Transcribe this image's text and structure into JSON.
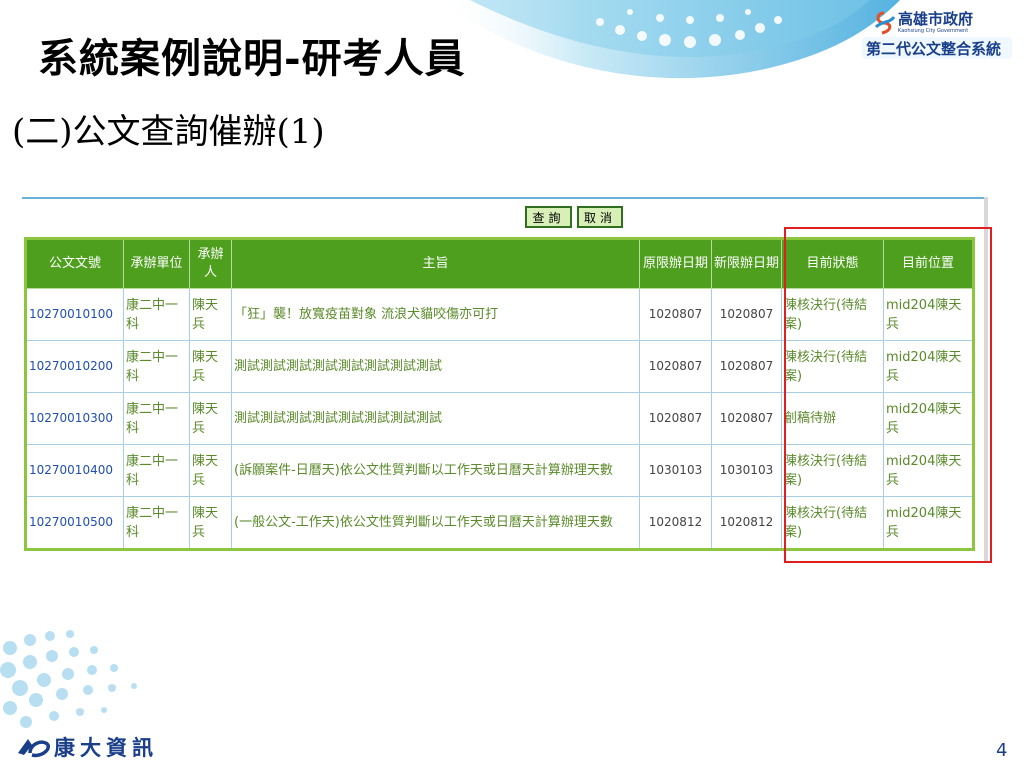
{
  "slide": {
    "title": "系統案例說明-研考人員",
    "subtitle": "(二)公文查詢催辦(1)",
    "page_number": "4"
  },
  "gov_logo": {
    "name": "高雄市政府",
    "english": "Kaohsiung City Government",
    "system": "第二代公文整合系統"
  },
  "company": {
    "name": "康大資訊"
  },
  "toolbar": {
    "query_label": "查詢",
    "cancel_label": "取消"
  },
  "table": {
    "columns": [
      "公文文號",
      "承辦單位",
      "承辦人",
      "主旨",
      "原限辦日期",
      "新限辦日期",
      "目前狀態",
      "目前位置"
    ],
    "rows": [
      {
        "doc_no": "10270010100",
        "unit": "康二中一科",
        "person": "陳天兵",
        "subject": "「狂」襲！放寬疫苗對象 流浪犬貓咬傷亦可打",
        "orig_date": "1020807",
        "new_date": "1020807",
        "status": "陳核決行(待結案)",
        "location": "mid204陳天兵"
      },
      {
        "doc_no": "10270010200",
        "unit": "康二中一科",
        "person": "陳天兵",
        "subject": "測試測試測試測試測試測試測試測試",
        "orig_date": "1020807",
        "new_date": "1020807",
        "status": "陳核決行(待結案)",
        "location": "mid204陳天兵"
      },
      {
        "doc_no": "10270010300",
        "unit": "康二中一科",
        "person": "陳天兵",
        "subject": "測試測試測試測試測試測試測試測試",
        "orig_date": "1020807",
        "new_date": "1020807",
        "status": "創稿待辦",
        "location": "mid204陳天兵"
      },
      {
        "doc_no": "10270010400",
        "unit": "康二中一科",
        "person": "陳天兵",
        "subject": "(訴願案件-日曆天)依公文性質判斷以工作天或日曆天計算辦理天數",
        "orig_date": "1030103",
        "new_date": "1030103",
        "status": "陳核決行(待結案)",
        "location": "mid204陳天兵"
      },
      {
        "doc_no": "10270010500",
        "unit": "康二中一科",
        "person": "陳天兵",
        "subject": "(一般公文-工作天)依公文性質判斷以工作天或日曆天計算辦理天數",
        "orig_date": "1020812",
        "new_date": "1020812",
        "status": "陳核決行(待結案)",
        "location": "mid204陳天兵"
      }
    ]
  },
  "colors": {
    "header_green": "#4f9f1f",
    "table_border": "#8cc63f",
    "doc_link": "#1f4fb0",
    "highlight_box": "#e02020"
  }
}
